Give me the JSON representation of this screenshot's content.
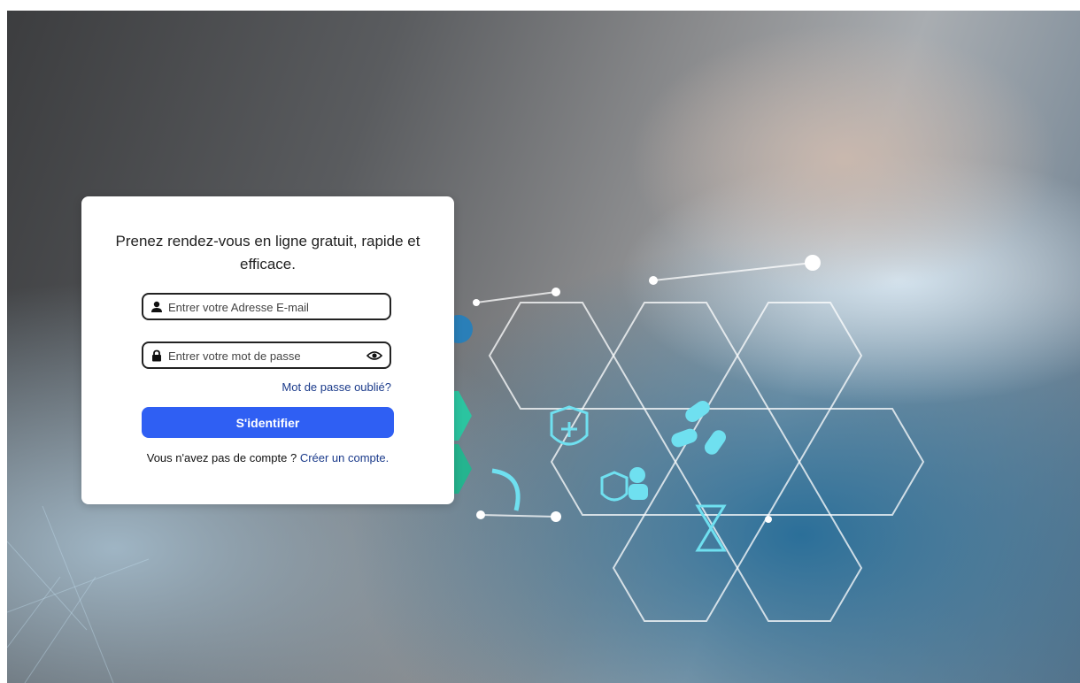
{
  "login": {
    "title": "Prenez rendez-vous en ligne gratuit, rapide et efficace.",
    "email": {
      "placeholder": "Entrer votre Adresse E-mail",
      "value": ""
    },
    "password": {
      "placeholder": "Entrer votre mot de passe",
      "value": ""
    },
    "forgot_link": "Mot de passe oublié?",
    "submit_label": "S'identifier",
    "no_account_text": "Vous n'avez pas de compte ?",
    "create_account_link": "Créer un compte."
  },
  "icons": {
    "email_field": "user-icon",
    "password_field": "lock-icon",
    "toggle_password": "eye-icon"
  },
  "colors": {
    "primary_button": "#2f5ff3",
    "link": "#1a3a8a",
    "card_background": "#ffffff",
    "field_border": "#222222"
  }
}
